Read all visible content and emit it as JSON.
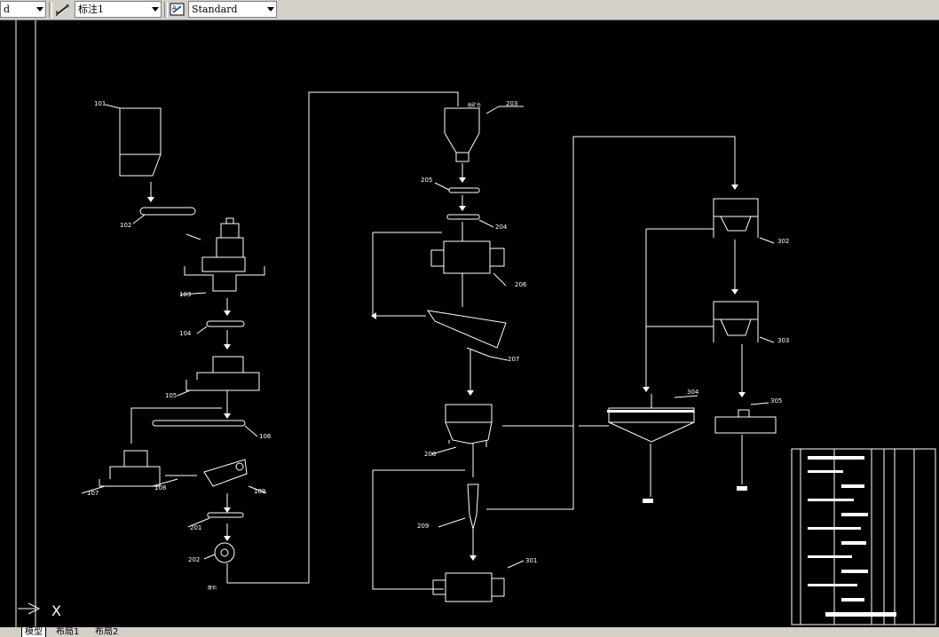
{
  "toolbar": {
    "layer_combo_value": "d",
    "dimstyle_combo_value": "标注1",
    "textstyle_combo_value": "Standard",
    "dimstyle_icon": "dimension-style-icon",
    "textstyle_icon": "text-style-icon"
  },
  "drawing": {
    "labels": {
      "l101": "101",
      "l102": "102",
      "l103": "103",
      "l104": "104",
      "l105": "105",
      "l106": "106",
      "l107": "107",
      "l108": "108",
      "l109": "109",
      "l201": "201",
      "l202": "202",
      "l203": "203",
      "l204": "204",
      "l205": "205",
      "l206": "206",
      "l207": "207",
      "l208": "208",
      "l209": "209",
      "l301": "301",
      "l302": "302",
      "l303": "303",
      "l304": "304",
      "l305": "305",
      "hopper_note": "给矿仓",
      "tailing_note": "废石"
    },
    "colors": {
      "line": "#ffffff",
      "background": "#000000"
    }
  },
  "tabs": {
    "model": "模型",
    "layout1": "布局1",
    "layout2": "布局2"
  }
}
